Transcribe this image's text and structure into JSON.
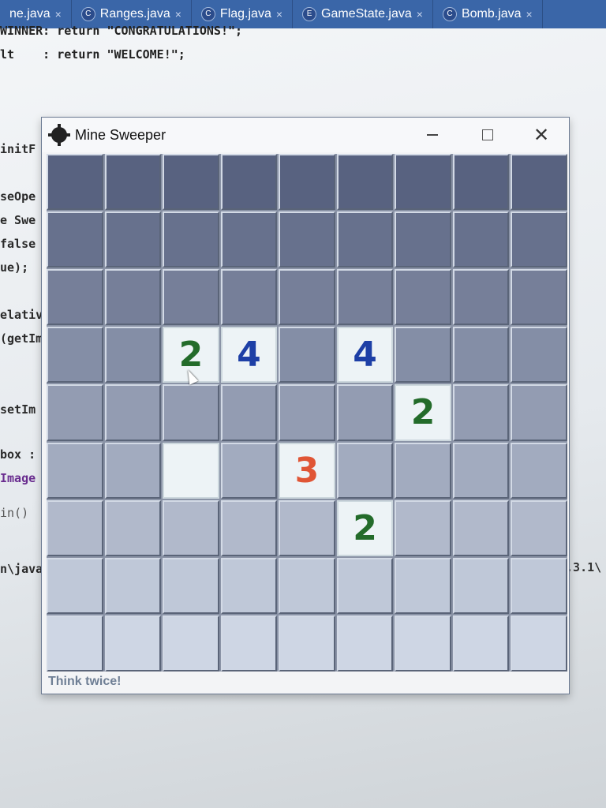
{
  "ide": {
    "tabs": [
      {
        "label": "ne.java",
        "close": "×"
      },
      {
        "label": "Ranges.java",
        "close": "×"
      },
      {
        "label": "Flag.java",
        "close": "×"
      },
      {
        "label": "GameState.java",
        "close": "×"
      },
      {
        "label": "Bomb.java",
        "close": "×"
      }
    ],
    "code_lines": [
      "WINNER: return \"CONGRATULATIONS!\";",
      "lt    : return \"WELCOME!\";"
    ],
    "code_fragments": [
      "initF",
      "seOpe",
      "e Swe",
      "false",
      "ue);",
      "elativ",
      "(getIm",
      "setIm",
      "box :",
      "Image",
      "in()",
      "n\\java"
    ],
    "code_right": "9.3.1\\"
  },
  "window": {
    "title": "Mine Sweeper",
    "minimize": "—",
    "maximize": "□",
    "close": "✕",
    "status": "Think twice!"
  },
  "board": {
    "rows": 9,
    "cols": 9,
    "number_colors": {
      "1": "#1d3fa6",
      "2": "#236b2a",
      "3": "#e05535",
      "4": "#1d3fa6"
    },
    "cells": [
      [
        "",
        "",
        "",
        "",
        "",
        "",
        "",
        "",
        ""
      ],
      [
        "",
        "",
        "",
        "",
        "",
        "",
        "",
        "",
        ""
      ],
      [
        "",
        "",
        "",
        "",
        "",
        "",
        "",
        "",
        ""
      ],
      [
        "",
        "",
        "2",
        "4",
        "",
        "4",
        "",
        "",
        ""
      ],
      [
        "",
        "",
        "",
        "",
        "",
        "",
        "2",
        "",
        ""
      ],
      [
        "",
        "",
        "",
        "",
        "3",
        "",
        "",
        "",
        ""
      ],
      [
        "",
        "",
        "",
        "",
        "",
        "2",
        "",
        "",
        ""
      ],
      [
        "",
        "",
        "",
        "",
        "",
        "",
        "",
        "",
        ""
      ],
      [
        "",
        "",
        "",
        "",
        "",
        "",
        "",
        "",
        ""
      ]
    ],
    "opened": [
      [
        0,
        0,
        0,
        0,
        0,
        0,
        0,
        0,
        0
      ],
      [
        0,
        0,
        0,
        0,
        0,
        0,
        0,
        0,
        0
      ],
      [
        0,
        0,
        0,
        0,
        0,
        0,
        0,
        0,
        0
      ],
      [
        0,
        0,
        1,
        1,
        0,
        1,
        0,
        0,
        0
      ],
      [
        0,
        0,
        0,
        0,
        0,
        0,
        1,
        0,
        0
      ],
      [
        0,
        0,
        1,
        0,
        1,
        0,
        0,
        0,
        0
      ],
      [
        0,
        0,
        0,
        0,
        0,
        1,
        0,
        0,
        0
      ],
      [
        0,
        0,
        0,
        0,
        0,
        0,
        0,
        0,
        0
      ],
      [
        0,
        0,
        0,
        0,
        0,
        0,
        0,
        0,
        0
      ]
    ]
  }
}
